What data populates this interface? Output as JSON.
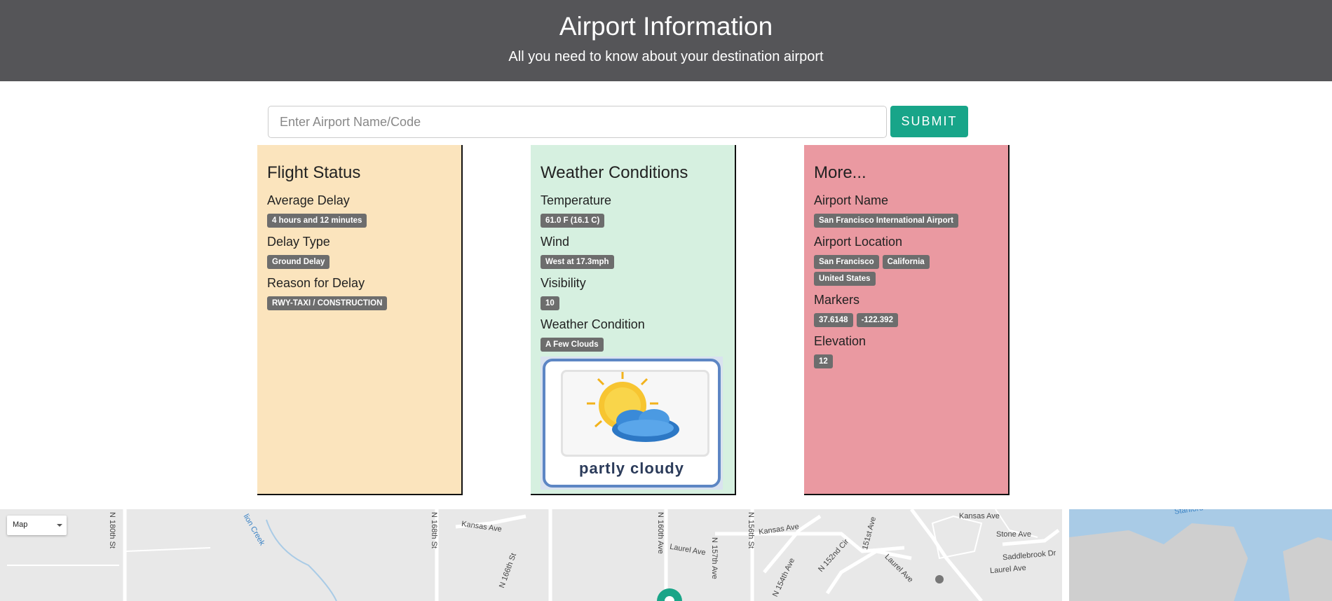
{
  "header": {
    "title": "Airport Information",
    "subtitle": "All you need to know about your destination airport"
  },
  "search": {
    "placeholder": "Enter Airport Name/Code",
    "submit_label": "SUBMIT"
  },
  "flight_status": {
    "title": "Flight Status",
    "average_delay_label": "Average Delay",
    "average_delay": "4 hours and 12 minutes",
    "delay_type_label": "Delay Type",
    "delay_type": "Ground Delay",
    "reason_label": "Reason for Delay",
    "reason": "RWY-TAXI / CONSTRUCTION"
  },
  "weather": {
    "title": "Weather Conditions",
    "temperature_label": "Temperature",
    "temperature": "61.0 F (16.1 C)",
    "wind_label": "Wind",
    "wind": "West at 17.3mph",
    "visibility_label": "Visibility",
    "visibility": "10",
    "condition_label": "Weather Condition",
    "condition": "A Few Clouds",
    "image_caption": "partly cloudy",
    "image_icon": "partly-cloudy-icon"
  },
  "more": {
    "title": "More...",
    "name_label": "Airport Name",
    "name": "San Francisco International Airport",
    "location_label": "Airport Location",
    "city": "San Francisco",
    "state": "California",
    "country": "United States",
    "markers_label": "Markers",
    "latitude": "37.6148",
    "longitude": "-122.392",
    "elevation_label": "Elevation",
    "elevation": "12"
  },
  "map": {
    "type_selector": "Map",
    "labels": {
      "n180": "N 180th St",
      "creek": "lion Creek",
      "n168": "N 168th St",
      "kansas1": "Kansas Ave",
      "n166": "N 166th St",
      "n160": "N 160th Ave",
      "laurel1": "Laurel Ave",
      "n157": "N 157th Ave",
      "n156": "N 156th St",
      "kansas2": "Kansas Ave",
      "n154": "N 154th Ave",
      "n152": "N 152nd Cir",
      "n151": "151st Ave",
      "laurel2": "Laurel Ave",
      "kansas3": "Kansas Ave",
      "stone": "Stone Ave",
      "saddle": "Saddlebrook Dr",
      "laurel3": "Laurel Ave",
      "stanford": "Stanford"
    },
    "colors": {
      "road": "#ffffff",
      "land": "#e8e8e8",
      "water": "#a9cbe6",
      "park": "#c9c9c9"
    }
  },
  "colors": {
    "header_bg": "#555558",
    "submit_bg": "#18a589",
    "flight_card_bg": "#fbe4bd",
    "weather_card_bg": "#d6f0e0",
    "more_card_bg": "#ea99a1",
    "badge_bg": "#6d6d6d"
  }
}
